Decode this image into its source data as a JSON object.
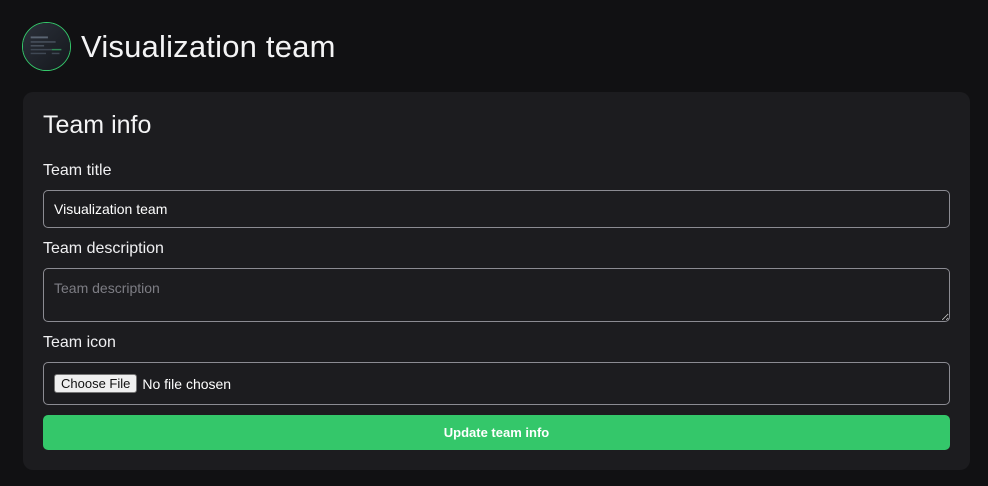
{
  "header": {
    "title": "Visualization team",
    "avatar_icon": "team-avatar-image"
  },
  "card": {
    "title": "Team info",
    "fields": {
      "title_label": "Team title",
      "title_value": "Visualization team",
      "description_label": "Team description",
      "description_placeholder": "Team description",
      "icon_label": "Team icon",
      "choose_file_label": "Choose File",
      "file_status": "No file chosen"
    },
    "submit_label": "Update team info"
  },
  "colors": {
    "accent": "#34c76a",
    "background": "#111113",
    "card_background": "#1c1c1f",
    "input_border": "#8b8b92"
  }
}
